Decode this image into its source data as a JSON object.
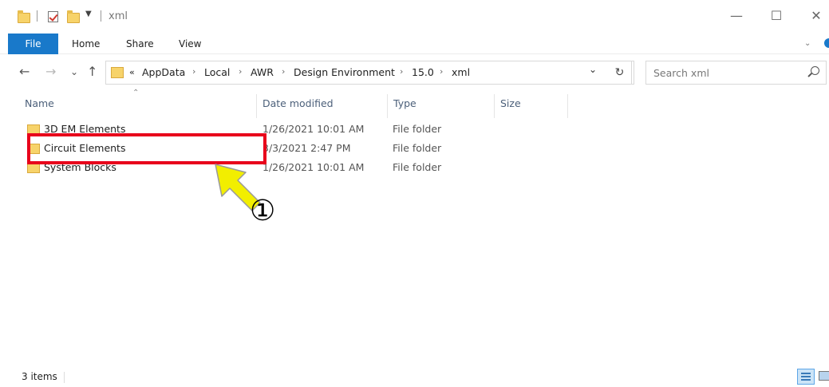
{
  "window": {
    "title": "xml",
    "minimize_glyph": "—",
    "maximize_glyph": "☐",
    "close_glyph": "✕"
  },
  "ribbon": {
    "tabs": [
      "File",
      "Home",
      "Share",
      "View"
    ]
  },
  "navigation": {
    "back_glyph": "←",
    "forward_glyph": "→",
    "recent_glyph": "⌄",
    "up_glyph": "↑",
    "overflow_glyph": "«",
    "breadcrumbs": [
      "AppData",
      "Local",
      "AWR",
      "Design Environment",
      "15.0",
      "xml"
    ],
    "crumb_separator": "›",
    "refresh_glyph": "↻",
    "dropdown_glyph": "⌄"
  },
  "search": {
    "placeholder": "Search xml"
  },
  "columns": [
    "Name",
    "Date modified",
    "Type",
    "Size"
  ],
  "files": [
    {
      "name": "3D EM Elements",
      "date": "1/26/2021 10:01 AM",
      "type": "File folder"
    },
    {
      "name": "Circuit Elements",
      "date": "3/3/2021 2:47 PM",
      "type": "File folder"
    },
    {
      "name": "System Blocks",
      "date": "1/26/2021 10:01 AM",
      "type": "File folder"
    }
  ],
  "annotation": {
    "label": "①",
    "highlight_color": "#e8001b",
    "arrow_color": "#f2ee00"
  },
  "status": {
    "item_count": "3 items"
  },
  "colors": {
    "accent": "#1979ca",
    "folder": "#f7d36a"
  }
}
